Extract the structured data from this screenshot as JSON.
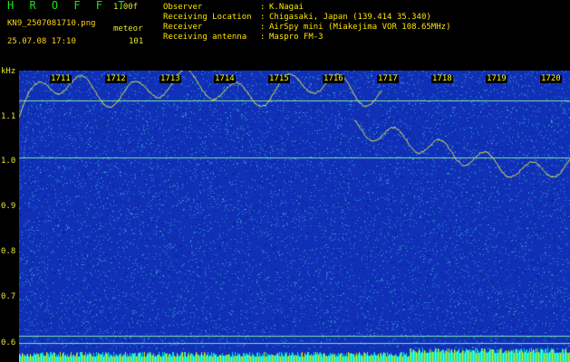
{
  "header": {
    "app_title": "H R O F F T",
    "version": "1.00f",
    "filename": "KN9_2507081710.png",
    "mode": "meteor",
    "datetime": "25.07.08 17:10",
    "count": "101",
    "info": [
      {
        "label": "Observer",
        "value": "K.Nagai"
      },
      {
        "label": "Receiving Location",
        "value": "Chigasaki, Japan (139.414 35.340)"
      },
      {
        "label": "Receiver",
        "value": "AirSpy mini (Miakejima VOR 108.65MHz)"
      },
      {
        "label": "Receiving antenna",
        "value": "Maspro FM-3"
      }
    ],
    "separator": ":"
  },
  "plot": {
    "y_unit": "kHz",
    "y_ticks": [
      {
        "label": "1.1",
        "value": 1.1
      },
      {
        "label": "1.0",
        "value": 1.0
      },
      {
        "label": "0.9",
        "value": 0.9
      },
      {
        "label": "0.8",
        "value": 0.8
      },
      {
        "label": "0.7",
        "value": 0.7
      },
      {
        "label": "0.6",
        "value": 0.6
      }
    ],
    "time_labels": [
      "1711",
      "1712",
      "1713",
      "1714",
      "1715",
      "1716",
      "1717",
      "1718",
      "1719",
      "1720"
    ],
    "colors": {
      "background": "#1030b8",
      "noise_dark": "#0a1a7a",
      "noise_light": "#3a8fd8",
      "trace": "#d8e84a",
      "reference_line": "#7ee6a8",
      "bottom_bar": "#00e6e6",
      "bottom_bar_alt": "#e6e600",
      "label_text": "#ffff00"
    }
  }
}
